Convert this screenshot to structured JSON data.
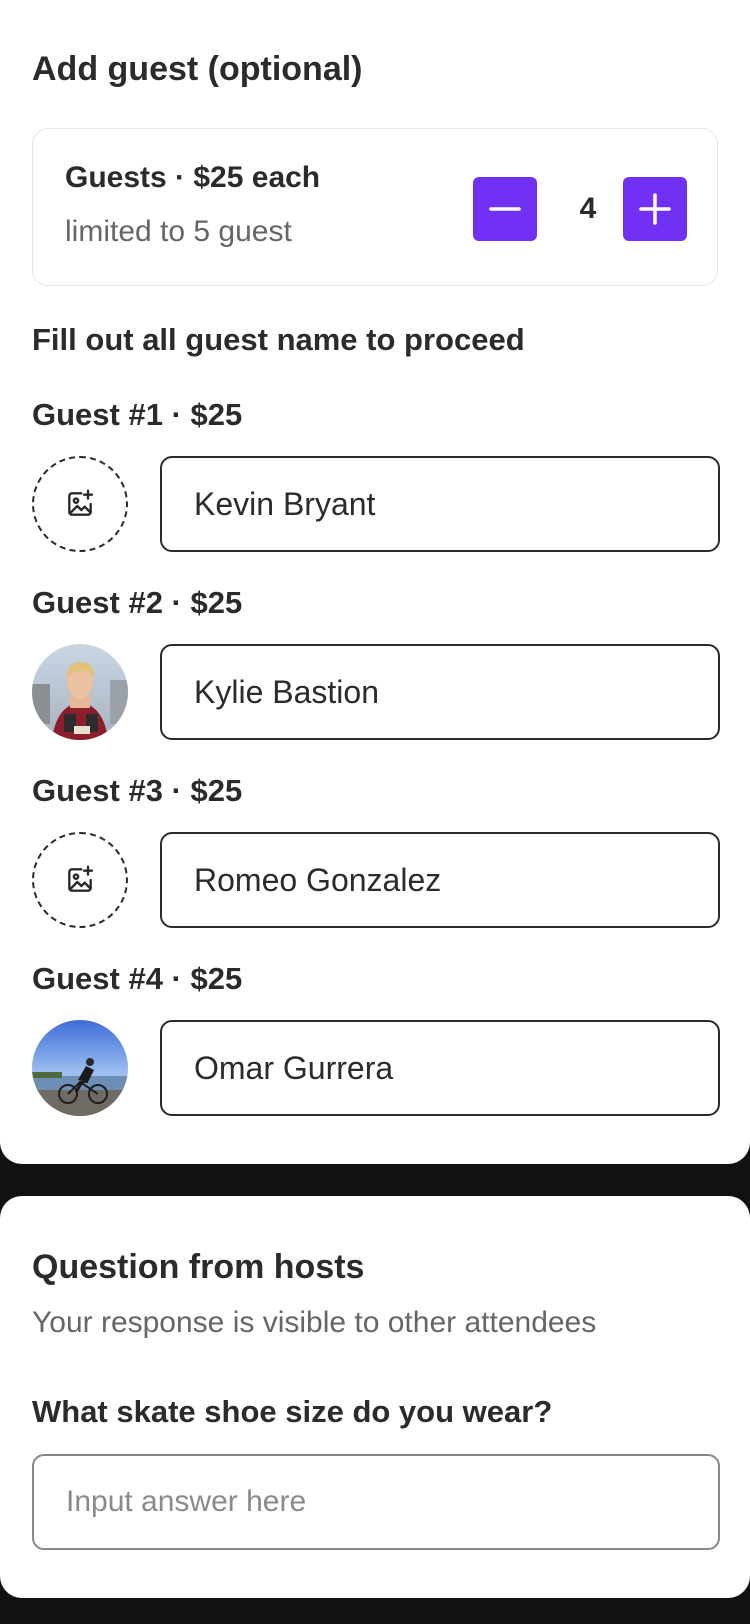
{
  "guest_section": {
    "title": "Add guest (optional)",
    "counter_title": "Guests · $25 each",
    "counter_subtitle": "limited to 5 guest",
    "count": "4",
    "accent_color": "#7131f5",
    "instruction": "Fill out all guest name to proceed"
  },
  "guests": [
    {
      "label": "Guest #1 · $25",
      "name": "Kevin Bryant",
      "avatar": "add-photo-icon"
    },
    {
      "label": "Guest #2 · $25",
      "name": "Kylie Bastion",
      "avatar": "photo"
    },
    {
      "label": "Guest #3 · $25",
      "name": "Romeo Gonzalez",
      "avatar": "add-photo-icon"
    },
    {
      "label": "Guest #4 · $25",
      "name": "Omar Gurrera",
      "avatar": "photo"
    }
  ],
  "host_section": {
    "title": "Question from hosts",
    "subtitle": "Your response is visible to other attendees",
    "question": "What skate shoe size do you wear?",
    "answer_placeholder": "Input answer here",
    "answer_value": ""
  }
}
